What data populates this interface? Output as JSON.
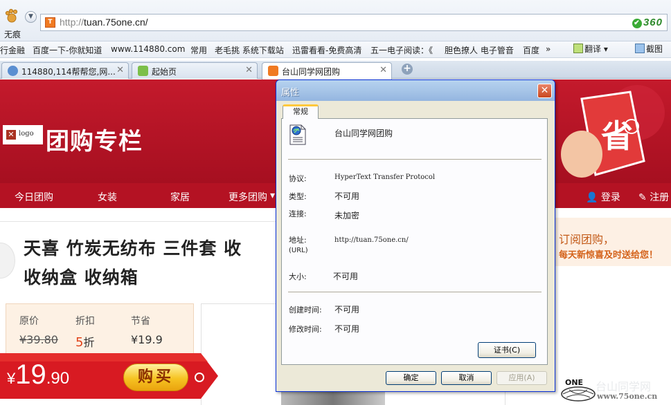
{
  "browser": {
    "traceless_label": "无痕",
    "address": {
      "scheme": "http://",
      "host": "tuan.75one.cn/"
    },
    "security_badge": "360",
    "bookmarks": [
      "行金融",
      "百度一下-你就知道",
      "www.114880.com",
      "常用",
      "老毛挑 系统下载站",
      "迅雷看看-免费高清",
      "五一电子阅读：《",
      "胆色撩人 电子管音",
      "百度"
    ],
    "bookmarks_more": "»",
    "tools": {
      "translate": "翻译",
      "screenshot": "截图"
    },
    "tabs": [
      {
        "title": "114880,114帮帮您,网...",
        "icon": "globe-icon",
        "active": false
      },
      {
        "title": "起始页",
        "icon": "start-page-icon",
        "active": false
      },
      {
        "title": "台山同学网团购",
        "icon": "site-favicon",
        "active": true
      }
    ],
    "close_glyph": "✕",
    "new_tab_glyph": "+"
  },
  "page": {
    "logo_alt": "logo",
    "site_title": "团购专栏",
    "nav": [
      "今日团购",
      "女装",
      "家居",
      "更多团购"
    ],
    "nav_dropdown": "▾",
    "user": {
      "login": "登录",
      "register": "注册"
    },
    "deal_title_line1": "天喜 竹炭无纺布 三件套 收",
    "deal_title_line2": "收纳盒 收纳箱",
    "subscribe_line1": "订阅团购，",
    "subscribe_line2": "每天新惊喜及时送给您！",
    "price": {
      "orig_label": "原价",
      "orig_value": "¥39.80",
      "discount_label": "折扣",
      "discount_num": "5",
      "discount_unit": "折",
      "save_label": "节省",
      "save_value": "¥19.9",
      "current_symbol": "¥",
      "current_int": "19",
      "current_dec": ".90",
      "buy_label": "购买"
    },
    "watermark": {
      "logo": "ONE",
      "text": "台山同学网",
      "url": "www.75one.cn"
    }
  },
  "dialog": {
    "title": "属性",
    "close": "✕",
    "tab": "常规",
    "name": "台山同学网团购",
    "fields": {
      "protocol": {
        "label": "协议:",
        "value": "HyperText Transfer Protocol"
      },
      "type": {
        "label": "类型:",
        "value": "不可用"
      },
      "connection": {
        "label": "连接:",
        "value": "未加密"
      },
      "address": {
        "label": "地址:",
        "label_sub": "(URL)",
        "value": "http://tuan.75one.cn/"
      },
      "size": {
        "label": "大小:",
        "value": "不可用"
      },
      "created": {
        "label": "创建时间:",
        "value": "不可用"
      },
      "modified": {
        "label": "修改时间:",
        "value": "不可用"
      }
    },
    "buttons": {
      "certificate": "证书(C)",
      "ok": "确定",
      "cancel": "取消",
      "apply": "应用(A)"
    }
  }
}
